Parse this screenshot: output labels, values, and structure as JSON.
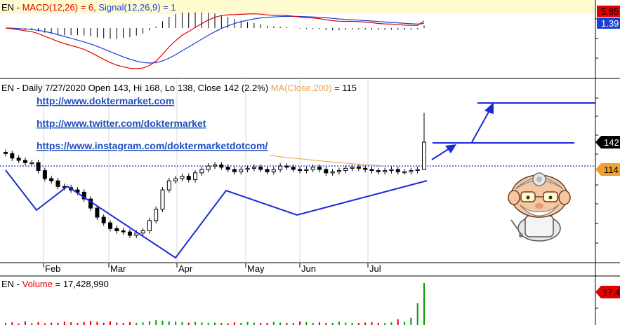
{
  "macd_panel": {
    "prefix": "EN - ",
    "macd_label": "MACD(12,26) = 6,",
    "signal_label": "Signal(12,26,9) = 1",
    "macd_badge": "5.85",
    "signal_badge": "1.39",
    "colors": {
      "macd": "#e00000",
      "signal": "#1a3fd6",
      "hist": "#000000"
    }
  },
  "price_panel": {
    "header_main": "EN - Daily 7/27/2020 Open 143, Hi 168, Lo 138, Close 142 (2.2%)",
    "header_ma": "MA(Close,200)",
    "header_ma_value": "= 115",
    "links": [
      "http://www.doktermarket.com",
      "http://www.twitter.com/doktermarket",
      "https://www.instagram.com/doktermarketdotcom/"
    ],
    "close_badge": "142",
    "ma_badge": "114",
    "colors": {
      "ma": "#e7a44a",
      "trend": "#1a2ad6",
      "badge_close": "#000000",
      "badge_ma": "#f0a030"
    }
  },
  "volume_panel": {
    "prefix": "EN - ",
    "label": "Volume",
    "value": "= 17,428,990",
    "badge": "17.4",
    "colors": {
      "up": "#00a000",
      "down": "#e00000"
    }
  },
  "x_axis": {
    "months": [
      "Feb",
      "Mar",
      "Apr",
      "May",
      "Jun",
      "Jul"
    ]
  },
  "chart_data": {
    "type": "line",
    "x_months": [
      "Feb",
      "Mar",
      "Apr",
      "May",
      "Jun",
      "Jul"
    ],
    "close_approx": [
      132,
      128,
      126,
      124,
      124,
      117,
      110,
      108,
      103,
      102,
      100,
      98,
      92,
      84,
      76,
      71,
      66,
      64,
      63,
      60,
      62,
      64,
      73,
      83,
      100,
      108,
      110,
      112,
      109,
      115,
      118,
      121,
      122,
      120,
      118,
      116,
      118,
      119,
      120,
      118,
      116,
      118,
      121,
      120,
      118,
      117,
      118,
      120,
      118,
      115,
      116,
      117,
      119,
      120,
      119,
      118,
      117,
      116,
      117,
      118,
      116,
      116,
      117,
      118,
      142
    ],
    "volume_approx": [
      0.9,
      1.1,
      0.6,
      1.5,
      0.8,
      1.2,
      0.7,
      1.0,
      0.9,
      1.4,
      1.1,
      0.8,
      1.2,
      1.7,
      1.3,
      0.9,
      1.5,
      1.0,
      0.8,
      1.2,
      0.9,
      1.1,
      1.6,
      2.0,
      1.8,
      1.5,
      1.4,
      1.2,
      1.0,
      1.3,
      1.1,
      0.9,
      1.0,
      0.8,
      0.7,
      1.1,
      0.9,
      1.2,
      1.0,
      0.8,
      0.9,
      1.3,
      1.0,
      0.9,
      0.8,
      1.5,
      1.2,
      0.9,
      1.1,
      0.8,
      0.9,
      1.4,
      1.0,
      0.9,
      0.8,
      1.0,
      1.2,
      0.9,
      0.8,
      1.1,
      2.4,
      1.3,
      3.0,
      9.0,
      17.4
    ],
    "ma200": 115,
    "last_close": 142,
    "volume_last": 17.4
  }
}
